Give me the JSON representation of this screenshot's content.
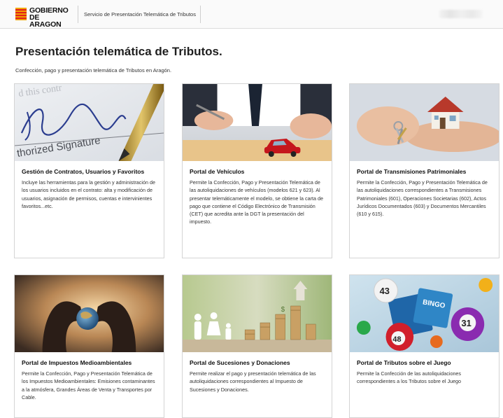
{
  "header": {
    "logo_line1": "GOBIERNO",
    "logo_line2": "DE ARAGON",
    "service_tab": "Servicio de Presentación Telemática de Tributos",
    "brand_color": "#e2231a",
    "accent_color": "#f2a900"
  },
  "page": {
    "title": "Presentación telemática de Tributos.",
    "subtitle": "Confección, pago y presentación telemática de Tributos en Aragón."
  },
  "cards": [
    {
      "title": "Gestión de Contratos, Usuarios y Favoritos",
      "text": "Incluye las herramientas para la gestión y administración de los usuarios incluidos en el contrato: alta y modificación de usuarios, asignación de permisos, cuentas e intervinientes favoritos...etc.",
      "image": "signature-pen-image"
    },
    {
      "title": "Portal de Vehículos",
      "text": "Permite la Confección, Pago y Presentación Telemática de las autoliquidaciones de vehículos (modelos 621 y 623). Al presentar telemáticamente el modelo, se obtiene la carta de pago que contiene el Código Electrónico de Transmisión (CET) que acredita ante la DGT la presentación del impuesto.",
      "image": "toy-car-signing-image"
    },
    {
      "title": "Portal de Transmisiones Patrimoniales",
      "text": "Permite la Confección, Pago y Presentación Telemática de las autoliquidaciones correspondientes a Transmisiones Patrimoniales (601), Operaciones Societarias (602), Actos Jurídicos Documentados (603) y Documentos Mercantiles (610 y 615).",
      "image": "house-keys-image"
    },
    {
      "title": "Portal de Impuestos Medioambientales",
      "text": "Permite la Confección, Pago y Presentación Telemática de los Impuestos Medioambientales: Emisiones contaminantes a la atmósfera, Grandes Áreas de Venta y Transportes por Cable.",
      "image": "hands-globe-image"
    },
    {
      "title": "Portal de Sucesiones y Donaciones",
      "text": "Permite realizar el pago y presentación telemática de las autoliquidaciones correspondientes al Impuesto de Sucesiones y Donaciones.",
      "image": "family-coins-image"
    },
    {
      "title": "Portal de Tributos sobre el Juego",
      "text": "Permite la Confección de las autoliquidaciones correspondientes a los Tributos sobre el Juego",
      "image": "bingo-balls-image",
      "image_labels": [
        "43",
        "BINGO",
        "31",
        "48"
      ]
    }
  ]
}
